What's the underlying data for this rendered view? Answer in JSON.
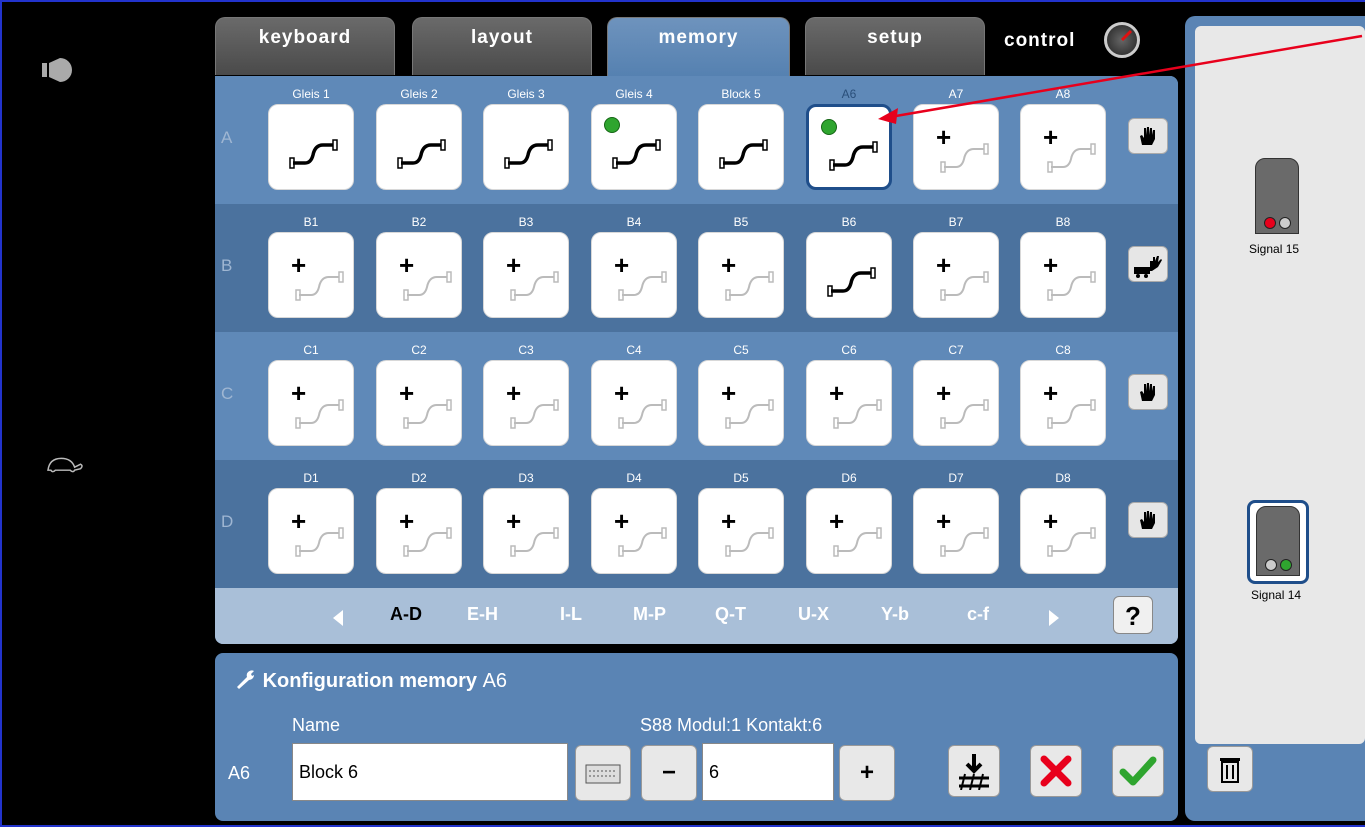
{
  "tabs": {
    "keyboard": "keyboard",
    "layout": "layout",
    "memory": "memory",
    "setup": "setup",
    "control": "control"
  },
  "left": {
    "top_icon": "speaker-icon",
    "turtle_icon": "turtle-icon"
  },
  "grid": {
    "rows": [
      {
        "letter": "A",
        "cells": [
          {
            "label": "Gleis 1",
            "state": "track"
          },
          {
            "label": "Gleis 2",
            "state": "track"
          },
          {
            "label": "Gleis 3",
            "state": "track"
          },
          {
            "label": "Gleis 4",
            "state": "track-active"
          },
          {
            "label": "Block 5",
            "state": "track"
          },
          {
            "label": "A6",
            "state": "track-active-selected"
          },
          {
            "label": "A7",
            "state": "empty"
          },
          {
            "label": "A8",
            "state": "empty"
          }
        ],
        "side_icon": "hand-icon"
      },
      {
        "letter": "B",
        "cells": [
          {
            "label": "B1",
            "state": "empty"
          },
          {
            "label": "B2",
            "state": "empty"
          },
          {
            "label": "B3",
            "state": "empty"
          },
          {
            "label": "B4",
            "state": "empty"
          },
          {
            "label": "B5",
            "state": "empty"
          },
          {
            "label": "B6",
            "state": "track"
          },
          {
            "label": "B7",
            "state": "empty"
          },
          {
            "label": "B8",
            "state": "empty"
          }
        ],
        "side_icon": "train-hand-icon"
      },
      {
        "letter": "C",
        "cells": [
          {
            "label": "C1",
            "state": "empty"
          },
          {
            "label": "C2",
            "state": "empty"
          },
          {
            "label": "C3",
            "state": "empty"
          },
          {
            "label": "C4",
            "state": "empty"
          },
          {
            "label": "C5",
            "state": "empty"
          },
          {
            "label": "C6",
            "state": "empty"
          },
          {
            "label": "C7",
            "state": "empty"
          },
          {
            "label": "C8",
            "state": "empty"
          }
        ],
        "side_icon": "hand-icon"
      },
      {
        "letter": "D",
        "cells": [
          {
            "label": "D1",
            "state": "empty"
          },
          {
            "label": "D2",
            "state": "empty"
          },
          {
            "label": "D3",
            "state": "empty"
          },
          {
            "label": "D4",
            "state": "empty"
          },
          {
            "label": "D5",
            "state": "empty"
          },
          {
            "label": "D6",
            "state": "empty"
          },
          {
            "label": "D7",
            "state": "empty"
          },
          {
            "label": "D8",
            "state": "empty"
          }
        ],
        "side_icon": "hand-icon"
      }
    ]
  },
  "pager": {
    "pages": [
      "A-D",
      "E-H",
      "I-L",
      "M-P",
      "Q-T",
      "U-X",
      "Y-b",
      "c-f"
    ],
    "active": "A-D",
    "help": "?"
  },
  "config": {
    "title_bold": "Konfiguration memory",
    "title_id": "A6",
    "name_label": "Name",
    "s88_label": "S88 Modul:1 Kontakt:6",
    "row_id": "A6",
    "name_value": "Block 6",
    "contact_value": "6",
    "minus": "−",
    "plus": "+"
  },
  "signals": [
    {
      "label": "Signal 15",
      "lit": "red"
    },
    {
      "label": "Signal 14",
      "lit": "green"
    }
  ],
  "colors": {
    "panel": "#5a84b4",
    "accent_red": "#e8001c",
    "accent_green": "#2fa52f"
  }
}
